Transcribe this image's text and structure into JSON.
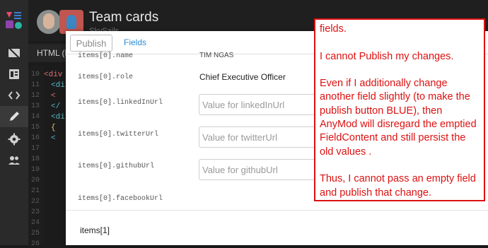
{
  "app": {
    "title": "Team cards",
    "subtitle": "SkySails"
  },
  "rail": {
    "items": [
      {
        "icon": "eye-off-icon"
      },
      {
        "icon": "document-icon"
      },
      {
        "icon": "code-icon"
      },
      {
        "icon": "pencil-icon",
        "active": true
      },
      {
        "icon": "gear-icon"
      },
      {
        "icon": "users-icon"
      }
    ]
  },
  "editor": {
    "tab_label": "HTML (H",
    "line_numbers": [
      "10",
      "11",
      "12",
      "13",
      "14",
      "15",
      "16",
      "17",
      "18",
      "19",
      "20",
      "21",
      "22",
      "23",
      "24",
      "25",
      "26"
    ],
    "code_lines": [
      "<div c",
      "<di",
      "<",
      "</",
      "<di",
      "{",
      "<",
      "",
      "",
      "",
      "",
      "",
      "",
      "",
      "",
      "",
      ""
    ]
  },
  "modal": {
    "publish_label": "Publish",
    "fields_tab_label": "Fields",
    "fields": [
      {
        "name": "items[0].name",
        "value": "TIM NGAS"
      },
      {
        "name": "items[0].role",
        "value": "Chief Executive Officer"
      },
      {
        "name": "items[0].linkedInUrl",
        "placeholder": "Value for linkedInUrl"
      },
      {
        "name": "items[0].twitterUrl",
        "placeholder": "Value for twitterUrl"
      },
      {
        "name": "items[0].githubUrl",
        "placeholder": "Value for githubUrl"
      },
      {
        "name": "items[0].facebookUrl",
        "placeholder": ""
      }
    ],
    "next_item_label": "items[1]"
  },
  "callout": {
    "paragraphs": [
      "fields.",
      "I cannot Publish my changes.",
      "Even if I additionally change another field slightly (to make the publish button BLUE),  then AnyMod will disregard the emptied FieldContent and still persist the old values .",
      "Thus, I cannot pass an empty field and publish that change."
    ]
  },
  "colors": {
    "accent": "#2f8dd6",
    "callout_red": "#dd1111",
    "background_dark": "#1b1b1b"
  }
}
